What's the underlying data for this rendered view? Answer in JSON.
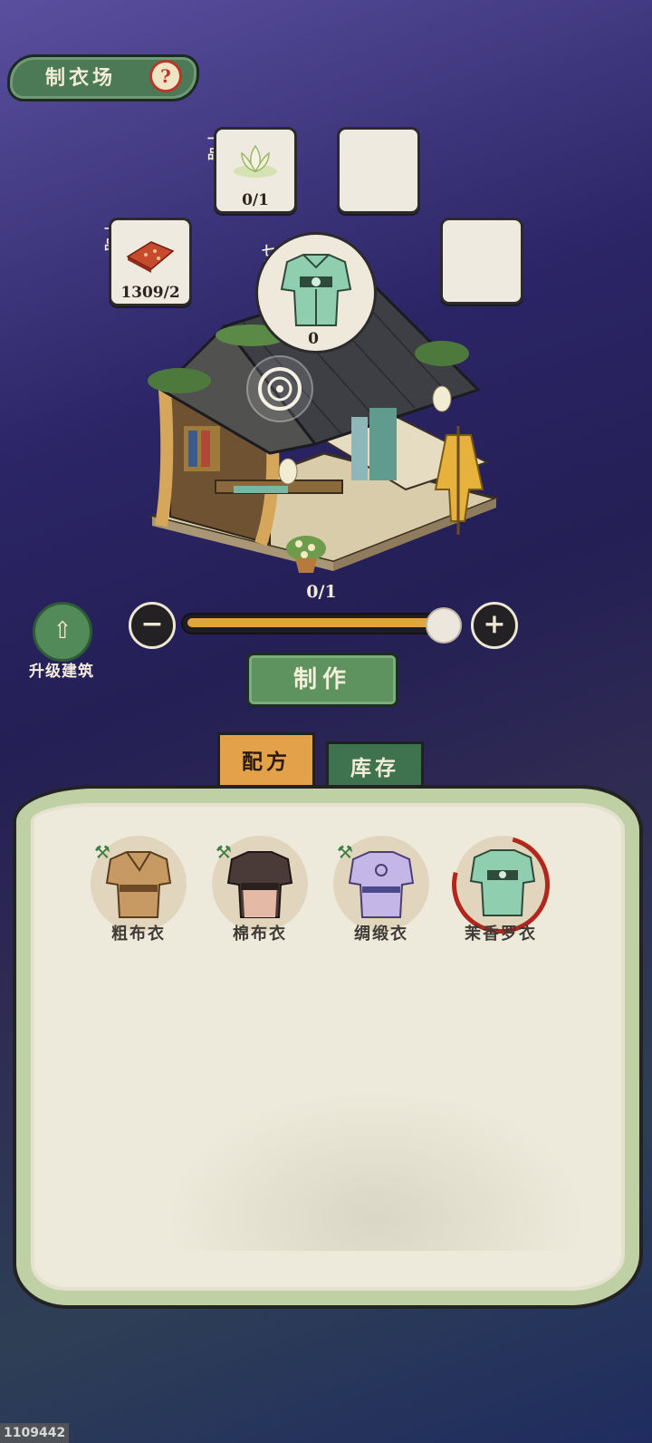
{
  "header": {
    "title": "制衣场",
    "help_icon": "question-mark"
  },
  "materials": [
    {
      "grade": "一品",
      "count": "0/1",
      "icon": "lotus-flower"
    },
    {
      "grade": "十品",
      "count": "1309/2",
      "icon": "red-cloth-bundle"
    }
  ],
  "product": {
    "grade": "七品",
    "count": "0",
    "icon": "green-robe"
  },
  "production": {
    "progress_label": "0/1",
    "slider_value_fraction": 0.95
  },
  "controls": {
    "minus_icon": "minus",
    "plus_icon": "plus"
  },
  "upgrade": {
    "label": "升级建筑",
    "icon": "upgrade-building"
  },
  "craft_button": {
    "label": "制作"
  },
  "tabs": {
    "recipes": "配方",
    "stock": "库存",
    "active": "recipes"
  },
  "recipes": [
    {
      "name": "粗布衣",
      "icon": "brown-robe",
      "craftable": true
    },
    {
      "name": "棉布衣",
      "icon": "dark-robe",
      "craftable": true
    },
    {
      "name": "绸缎衣",
      "icon": "lavender-robe",
      "craftable": true
    },
    {
      "name": "茉香罗衣",
      "icon": "green-robe",
      "craftable": false,
      "selected": true
    }
  ],
  "footer": {
    "id": "1109442"
  },
  "colors": {
    "accent_green": "#5e9360",
    "tab_orange": "#e3a14a",
    "slider_fill": "#e2a53a",
    "selection_red": "#b0271d"
  }
}
